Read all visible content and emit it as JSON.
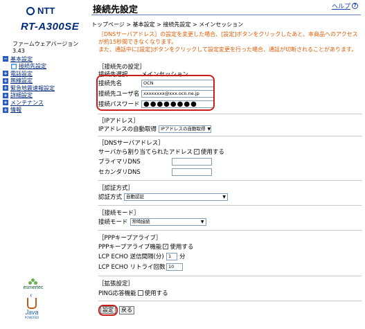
{
  "sidebar": {
    "brand": "NTT",
    "model": "RT-A300SE",
    "firmware": "ファームウェアバージョン 3.43",
    "nav": [
      {
        "label": "基本設定",
        "box": "−"
      },
      {
        "label": "接続先設定",
        "box": "■"
      },
      {
        "label": "電話設定",
        "box": "+"
      },
      {
        "label": "無線設定",
        "box": "+"
      },
      {
        "label": "緊急地震速報設定",
        "box": "+"
      },
      {
        "label": "詳細設定",
        "box": "+"
      },
      {
        "label": "メンテナンス",
        "box": "+"
      },
      {
        "label": "情報",
        "box": "+"
      }
    ],
    "esmertec": "esmertec",
    "java": "Java",
    "java_sub": "POWERED"
  },
  "header": {
    "title": "接続先設定",
    "help": "ヘルプ",
    "help_icon": "?"
  },
  "breadcrumb": "トップページ > 基本設定 > 接続先設定 > メインセッション",
  "notice": [
    "［DNSサーバアドレス］の設定を変更した場合、[設定]ボタンをクリックしたあと、本商品へのアクセスが約15秒間できなくなります。",
    "また、通話中に[設定]ボタンをクリックして設定変更を行った場合、通話が切断されることがあります。"
  ],
  "connection": {
    "section": "［接続先の設定］",
    "select_label": "接続先選択",
    "select_value": "メインセッション",
    "name_label": "接続先名",
    "name_value": "OCN",
    "user_label": "接続先ユーザ名",
    "user_value": "xxxxxxxx@xxx.ocn.ne.jp",
    "password_label": "接続パスワード",
    "password_value": "●●●●●●●●"
  },
  "ip": {
    "section": "［IPアドレス］",
    "auto_label": "IPアドレスの自動取得",
    "auto_value": "IPアドレスの自動取得"
  },
  "dns": {
    "section": "［DNSサーバアドレス］",
    "assigned_label": "サーバから割り当てられたアドレス",
    "assigned_check": "使用する",
    "primary_label": "プライマリDNS",
    "secondary_label": "セカンダリDNS",
    "primary_value": "",
    "secondary_value": ""
  },
  "auth": {
    "section": "［認証方式］",
    "label": "認証方式",
    "value": "自動認証"
  },
  "mode": {
    "section": "［接続モード］",
    "label": "接続モード",
    "value": "常時接続"
  },
  "keepalive": {
    "section": "［PPPキープアライブ］",
    "feature_label": "PPPキープアライブ機能",
    "feature_check": "使用する",
    "interval_label": "LCP ECHO 送信間隔(分)",
    "interval_value": "1",
    "interval_unit": "分",
    "retry_label": "LCP ECHO リトライ回数",
    "retry_value": "10"
  },
  "ext": {
    "section": "［拡張設定］",
    "ping_label": "PING応答機能",
    "ping_check": "使用する"
  },
  "buttons": {
    "set": "設定",
    "back": "戻る"
  },
  "colors": {
    "accent": "#002a7a",
    "notice": "#e05a00",
    "highlight": "#cc1b1b",
    "link": "#1a3fb0"
  }
}
